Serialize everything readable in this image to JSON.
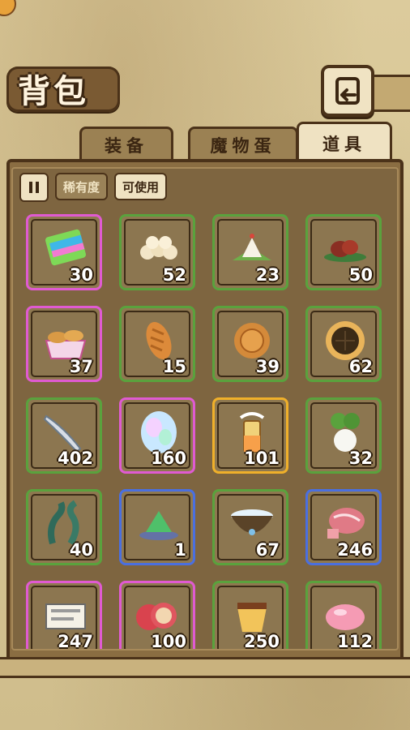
{
  "header": {
    "title": "背包",
    "back_icon": "return-arrow-icon"
  },
  "tabs": [
    {
      "label": "装备",
      "active": false
    },
    {
      "label": "魔物蛋",
      "active": false
    },
    {
      "label": "道具",
      "active": true
    }
  ],
  "filters": {
    "sort_icon": "pause-sort-icon",
    "rarity_label": "稀有度",
    "usable_label": "可使用",
    "usable_active": true
  },
  "colors": {
    "rarity_green": "#5aa23d",
    "rarity_purple": "#e05ad2",
    "rarity_blue": "#4a6fe0",
    "rarity_gold": "#f0b02a"
  },
  "items": [
    {
      "icon": "rainbow-cake-icon",
      "count": "30",
      "rarity": "purple"
    },
    {
      "icon": "bun-pile-icon",
      "count": "52",
      "rarity": "green"
    },
    {
      "icon": "rice-dumpling-icon",
      "count": "23",
      "rarity": "green"
    },
    {
      "icon": "meat-dish-icon",
      "count": "50",
      "rarity": "green"
    },
    {
      "icon": "bread-basket-icon",
      "count": "37",
      "rarity": "purple"
    },
    {
      "icon": "bread-loaf-icon",
      "count": "15",
      "rarity": "green"
    },
    {
      "icon": "mooncake-icon",
      "count": "39",
      "rarity": "green"
    },
    {
      "icon": "pie-icon",
      "count": "62",
      "rarity": "green"
    },
    {
      "icon": "fish-icon",
      "count": "402",
      "rarity": "green"
    },
    {
      "icon": "crystal-egg-icon",
      "count": "160",
      "rarity": "purple"
    },
    {
      "icon": "magic-drink-icon",
      "count": "101",
      "rarity": "gold"
    },
    {
      "icon": "radish-icon",
      "count": "32",
      "rarity": "green"
    },
    {
      "icon": "seaweed-icon",
      "count": "40",
      "rarity": "green"
    },
    {
      "icon": "green-crystal-icon",
      "count": "1",
      "rarity": "blue"
    },
    {
      "icon": "milk-bowl-icon",
      "count": "67",
      "rarity": "green"
    },
    {
      "icon": "raw-meat-icon",
      "count": "246",
      "rarity": "blue"
    },
    {
      "icon": "ticket-bundle-icon",
      "count": "247",
      "rarity": "purple"
    },
    {
      "icon": "ham-slices-icon",
      "count": "100",
      "rarity": "purple"
    },
    {
      "icon": "pudding-icon",
      "count": "250",
      "rarity": "green"
    },
    {
      "icon": "pink-jelly-icon",
      "count": "112",
      "rarity": "green"
    }
  ]
}
